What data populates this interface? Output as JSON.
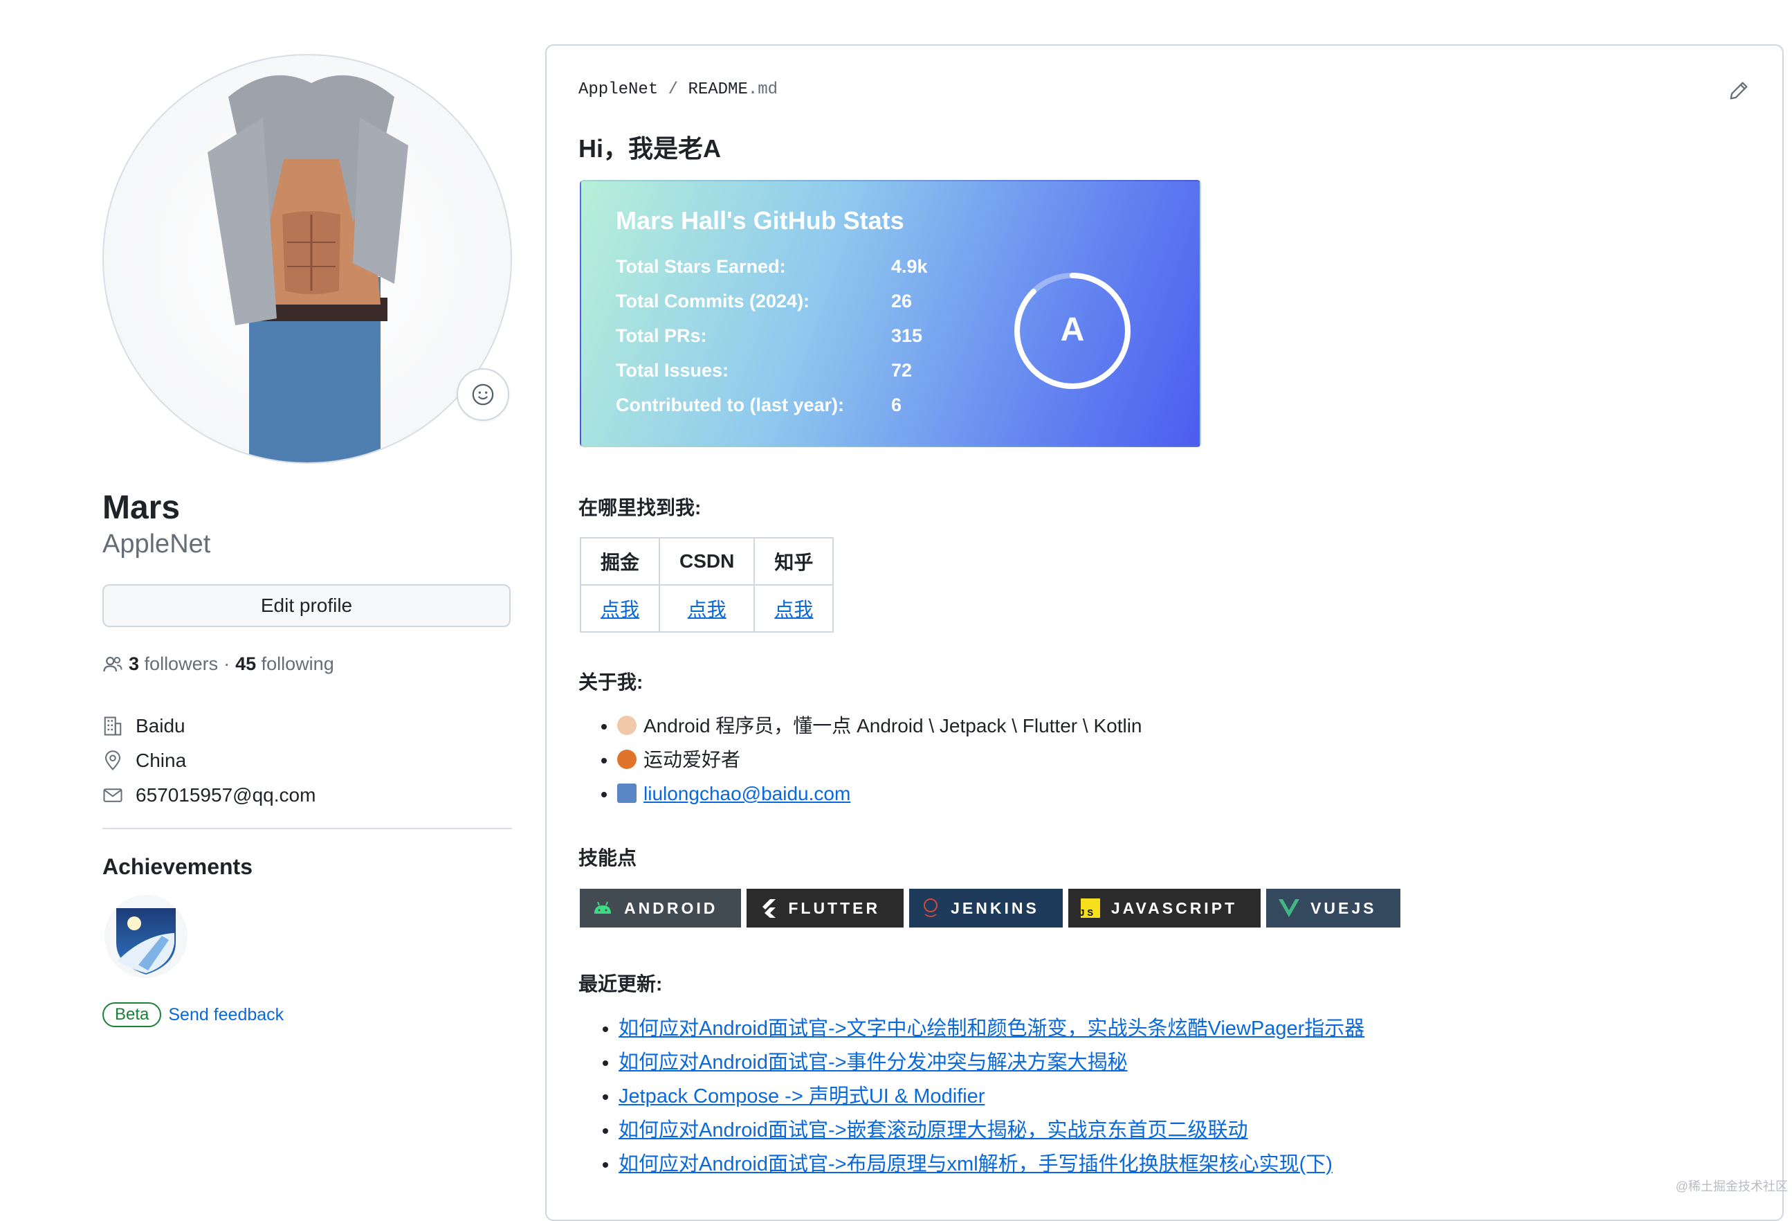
{
  "profile": {
    "fullname": "Mars",
    "username": "AppleNet",
    "edit_label": "Edit profile",
    "followers_count": "3",
    "followers_label": "followers",
    "separator": "·",
    "following_count": "45",
    "following_label": "following",
    "company": "Baidu",
    "location": "China",
    "email": "657015957@qq.com",
    "achievements_title": "Achievements",
    "beta_label": "Beta",
    "feedback_label": "Send feedback"
  },
  "readme": {
    "crumb_owner": "AppleNet",
    "crumb_sep": "/",
    "crumb_file": "README",
    "crumb_ext": ".md",
    "heading": "Hi，我是老A",
    "stats": {
      "title": "Mars Hall's GitHub Stats",
      "rows": [
        {
          "label": "Total Stars Earned:",
          "value": "4.9k"
        },
        {
          "label": "Total Commits (2024):",
          "value": "26"
        },
        {
          "label": "Total PRs:",
          "value": "315"
        },
        {
          "label": "Total Issues:",
          "value": "72"
        },
        {
          "label": "Contributed to (last year):",
          "value": "6"
        }
      ],
      "grade": "A"
    },
    "where_title": "在哪里找到我:",
    "where_headers": [
      "掘金",
      "CSDN",
      "知乎"
    ],
    "where_links": [
      "点我",
      "点我",
      "点我"
    ],
    "about_title": "关于我:",
    "about_items": [
      "Android 程序员，懂一点 Android \\ Jetpack \\ Flutter \\ Kotlin",
      "运动爱好者",
      "liulongchao@baidu.com"
    ],
    "skills_title": "技能点",
    "skills": [
      {
        "label": "ANDROID",
        "bg": "#424a52",
        "icon": "android-icon"
      },
      {
        "label": "FLUTTER",
        "bg": "#2b2b2b",
        "icon": "flutter-icon"
      },
      {
        "label": "JENKINS",
        "bg": "#1f3b5c",
        "icon": "jenkins-icon"
      },
      {
        "label": "JAVASCRIPT",
        "bg": "#2b2b2b",
        "icon": "javascript-icon"
      },
      {
        "label": "VUEJS",
        "bg": "#35495e",
        "icon": "vuejs-icon"
      }
    ],
    "recent_title": "最近更新:",
    "recent_items": [
      "如何应对Android面试官->文字中心绘制和颜色渐变，实战头条炫酷ViewPager指示器",
      "如何应对Android面试官->事件分发冲突与解决方案大揭秘",
      "Jetpack Compose -> 声明式UI & Modifier",
      "如何应对Android面试官->嵌套滚动原理大揭秘，实战京东首页二级联动",
      "如何应对Android面试官->布局原理与xml解析，手写插件化换肤框架核心实现(下)"
    ]
  },
  "watermark": "@稀土掘金技术社区",
  "colors": {
    "link": "#0969da",
    "text": "#1f2328",
    "muted": "#656d76",
    "border": "#d0d7de"
  }
}
